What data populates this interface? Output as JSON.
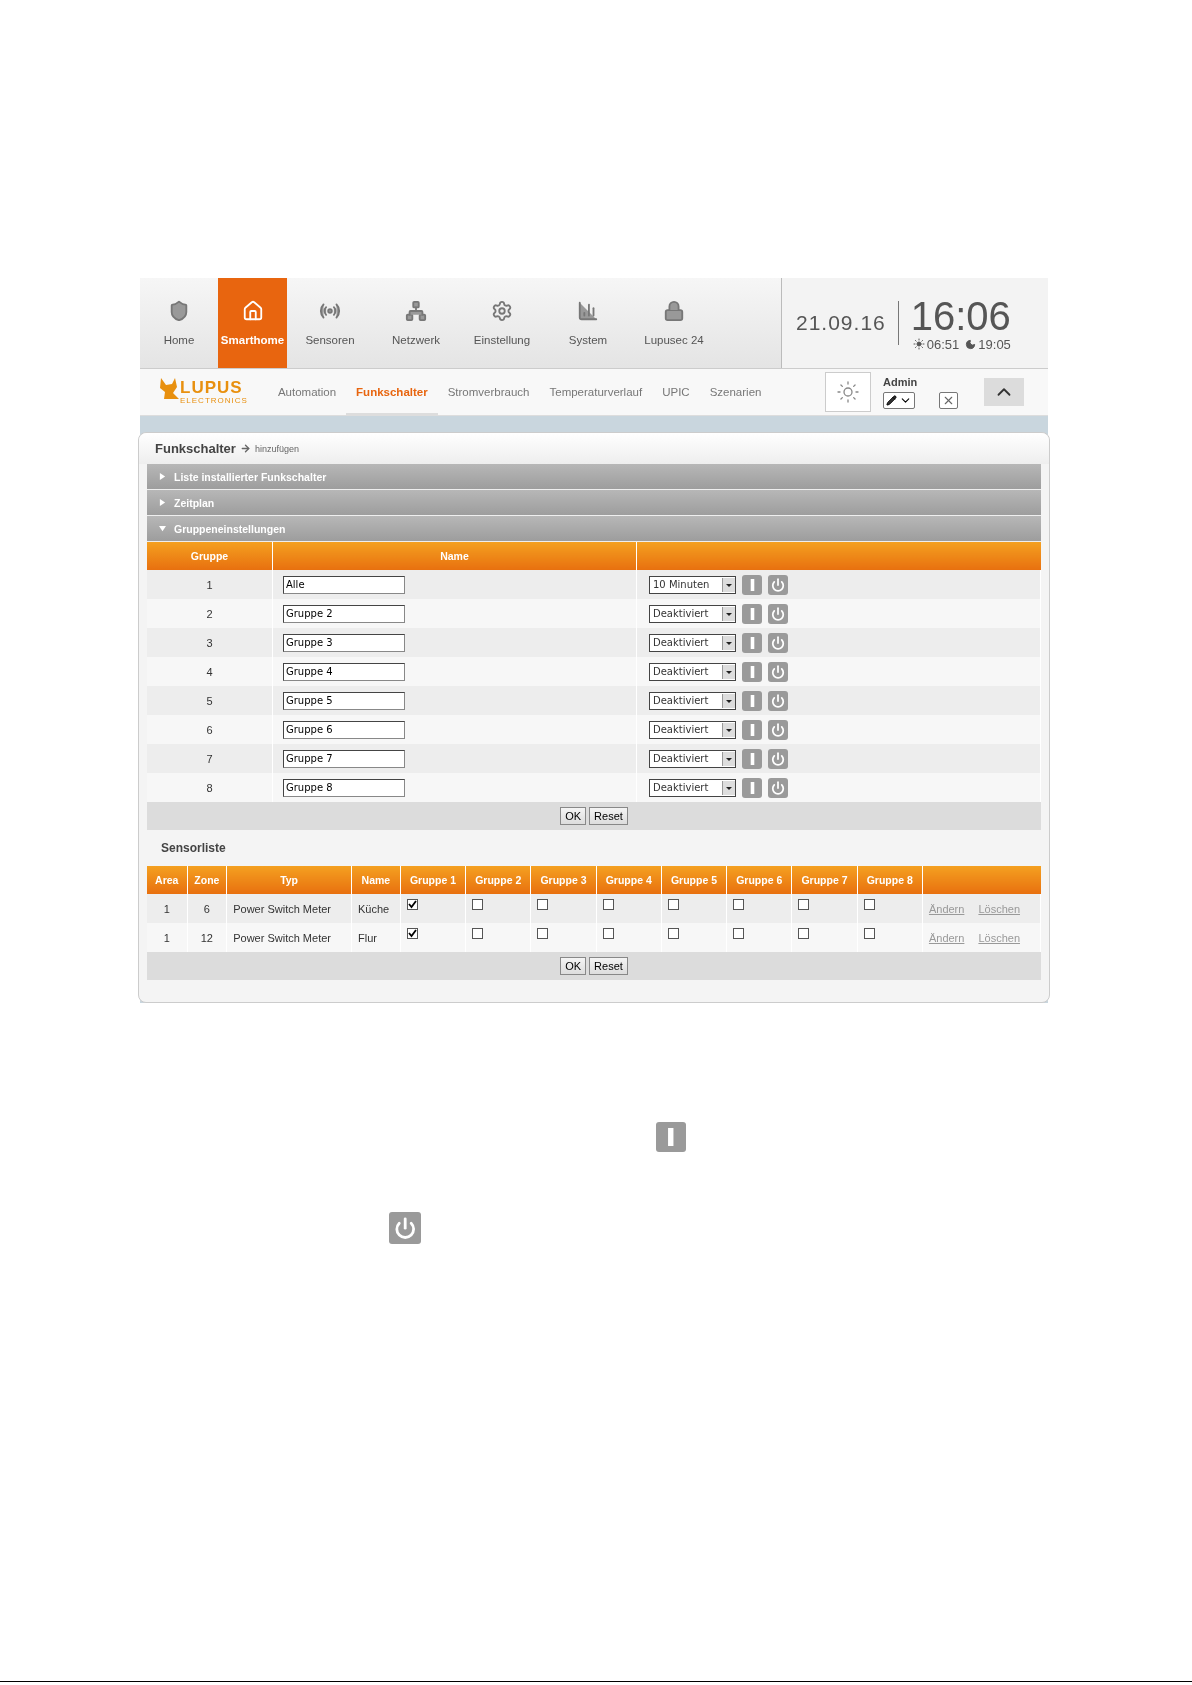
{
  "nav": {
    "items": [
      {
        "label": "Home",
        "selected": false
      },
      {
        "label": "Smarthome",
        "selected": true
      },
      {
        "label": "Sensoren",
        "selected": false
      },
      {
        "label": "Netzwerk",
        "selected": false
      },
      {
        "label": "Einstellung",
        "selected": false
      },
      {
        "label": "System",
        "selected": false
      },
      {
        "label": "Lupusec 24",
        "selected": false
      }
    ]
  },
  "clock": {
    "date": "21.09.16",
    "time": "16:06",
    "sunrise": "06:51",
    "sunset": "19:05"
  },
  "logo": {
    "name": "LUPUS",
    "sub": "ELECTRONICS"
  },
  "subnav": {
    "items": [
      {
        "label": "Automation",
        "selected": false
      },
      {
        "label": "Funkschalter",
        "selected": true
      },
      {
        "label": "Stromverbrauch",
        "selected": false
      },
      {
        "label": "Temperaturverlauf",
        "selected": false
      },
      {
        "label": "UPIC",
        "selected": false
      },
      {
        "label": "Szenarien",
        "selected": false
      }
    ]
  },
  "user": {
    "name": "Admin"
  },
  "card": {
    "title": "Funkschalter",
    "link": "hinzufügen"
  },
  "sections": [
    {
      "label": "Liste installierter Funkschalter",
      "expanded": false
    },
    {
      "label": "Zeitplan",
      "expanded": false
    },
    {
      "label": "Gruppeneinstellungen",
      "expanded": true
    }
  ],
  "groups": {
    "columns": [
      "Gruppe",
      "Name"
    ],
    "rows": [
      {
        "number": "1",
        "name": "Alle",
        "timer": "10 Minuten"
      },
      {
        "number": "2",
        "name": "Gruppe 2",
        "timer": "Deaktiviert"
      },
      {
        "number": "3",
        "name": "Gruppe 3",
        "timer": "Deaktiviert"
      },
      {
        "number": "4",
        "name": "Gruppe 4",
        "timer": "Deaktiviert"
      },
      {
        "number": "5",
        "name": "Gruppe 5",
        "timer": "Deaktiviert"
      },
      {
        "number": "6",
        "name": "Gruppe 6",
        "timer": "Deaktiviert"
      },
      {
        "number": "7",
        "name": "Gruppe 7",
        "timer": "Deaktiviert"
      },
      {
        "number": "8",
        "name": "Gruppe 8",
        "timer": "Deaktiviert"
      }
    ],
    "buttons": [
      "OK",
      "Reset"
    ]
  },
  "sensors": {
    "title": "Sensorliste",
    "columns": [
      "Area",
      "Zone",
      "Typ",
      "Name",
      "Gruppe 1",
      "Gruppe 2",
      "Gruppe 3",
      "Gruppe 4",
      "Gruppe 5",
      "Gruppe 6",
      "Gruppe 7",
      "Gruppe 8"
    ],
    "rows": [
      {
        "area": "1",
        "zone": "6",
        "type": "Power Switch Meter",
        "name": "Küche",
        "groups": [
          true,
          false,
          false,
          false,
          false,
          false,
          false,
          false
        ],
        "actions": [
          "Ändern",
          "Löschen"
        ]
      },
      {
        "area": "1",
        "zone": "12",
        "type": "Power Switch Meter",
        "name": "Flur",
        "groups": [
          true,
          false,
          false,
          false,
          false,
          false,
          false,
          false
        ],
        "actions": [
          "Ändern",
          "Löschen"
        ]
      }
    ],
    "buttons": [
      "OK",
      "Reset"
    ]
  }
}
